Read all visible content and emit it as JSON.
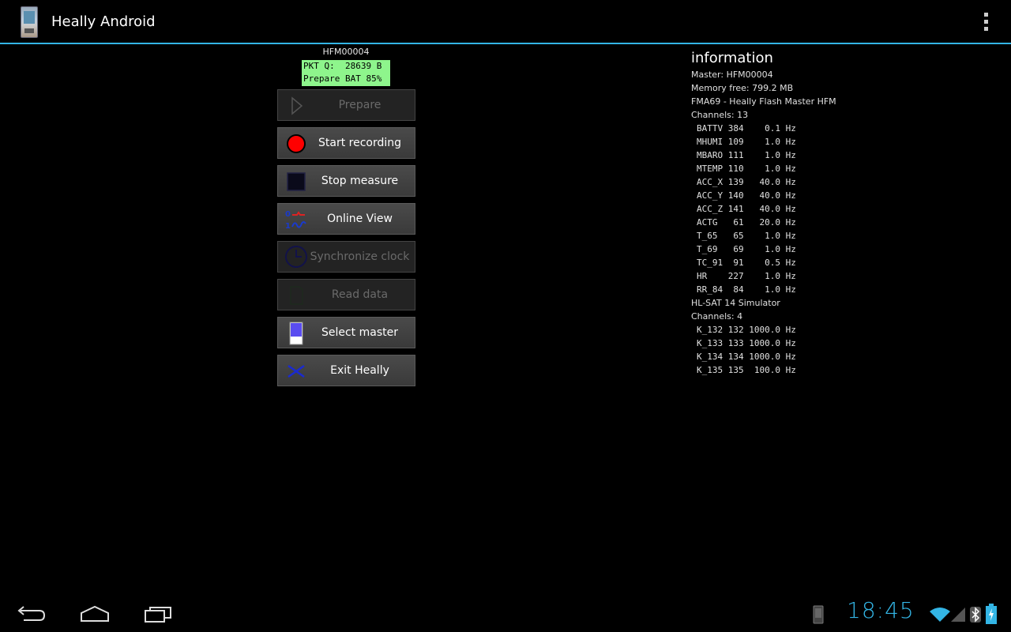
{
  "actionbar": {
    "title": "Heally Android"
  },
  "device": {
    "id": "HFM00004",
    "status_lines": [
      "PKT Q:  28639 B",
      "Prepare BAT 85%"
    ]
  },
  "buttons": [
    {
      "label": "Prepare",
      "icon": "play-icon",
      "enabled": false
    },
    {
      "label": "Start recording",
      "icon": "record-icon",
      "enabled": true
    },
    {
      "label": "Stop measure",
      "icon": "stop-icon",
      "enabled": true
    },
    {
      "label": "Online View",
      "icon": "waveform-icon",
      "enabled": true
    },
    {
      "label": "Synchronize clock",
      "icon": "clock-icon",
      "enabled": false
    },
    {
      "label": "Read data",
      "icon": "document-icon",
      "enabled": false
    },
    {
      "label": "Select master",
      "icon": "device-icon",
      "enabled": true
    },
    {
      "label": "Exit Heally",
      "icon": "x-icon",
      "enabled": true
    }
  ],
  "info": {
    "title": "information",
    "lines": [
      "Master: HFM00004",
      "Memory free: 799.2 MB",
      "FMA69 - Heally Flash Master HFM",
      "Channels: 13"
    ],
    "channels1": [
      "BATTV 384    0.1 Hz",
      "MHUMI 109    1.0 Hz",
      "MBARO 111    1.0 Hz",
      "MTEMP 110    1.0 Hz",
      "ACC_X 139   40.0 Hz",
      "ACC_Y 140   40.0 Hz",
      "ACC_Z 141   40.0 Hz",
      "ACTG   61   20.0 Hz",
      "T_65   65    1.0 Hz",
      "T_69   69    1.0 Hz",
      "TC_91  91    0.5 Hz",
      "HR    227    1.0 Hz",
      "RR_84  84    1.0 Hz"
    ],
    "device2": "HL-SAT 14 Simulator",
    "channels2_label": "Channels: 4",
    "channels2": [
      "K_132 132 1000.0 Hz",
      "K_133 133 1000.0 Hz",
      "K_134 134 1000.0 Hz",
      "K_135 135  100.0 Hz"
    ]
  },
  "statusbar": {
    "clock": "18:45"
  },
  "colors": {
    "accent": "#33b5e5",
    "status_box": "#8ef58c",
    "record": "#ff0000"
  }
}
